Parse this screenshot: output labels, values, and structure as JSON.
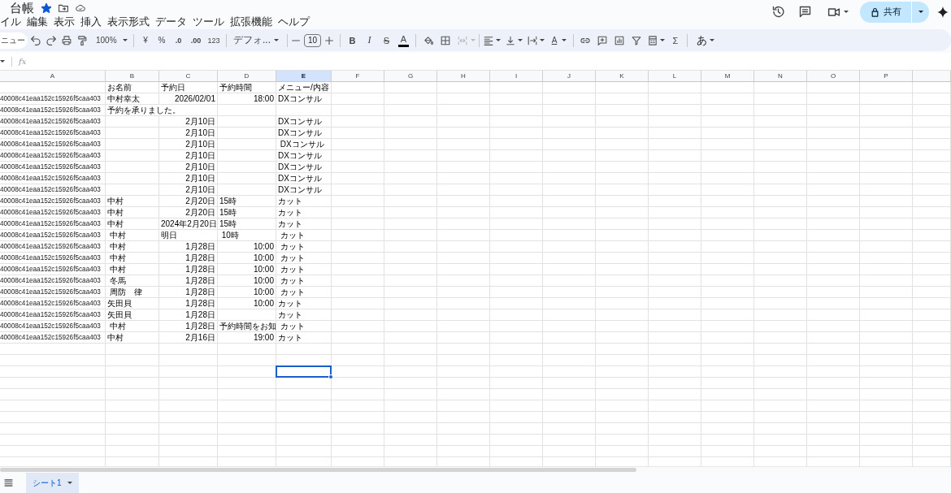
{
  "document": {
    "title": "台帳",
    "starred": true
  },
  "menu": [
    "イル",
    "編集",
    "表示",
    "挿入",
    "表示形式",
    "データ",
    "ツール",
    "拡張機能",
    "ヘルプ"
  ],
  "share_button": {
    "label": "共有"
  },
  "toolbar": {
    "search_placeholder": "ニュー",
    "zoom": "100%",
    "currency": "¥",
    "percent": "%",
    "decimal_decrease": ".0",
    "decimal_increase": ".00",
    "number_format": "123",
    "font": "デフォ...",
    "font_size": "10",
    "bold": "B",
    "italic": "I",
    "strikethrough": "S",
    "text_color": "A",
    "merge_cells": {
      "disabled": true
    },
    "text_rotation": "A",
    "sum": "Σ",
    "input_tools": "あ"
  },
  "formula_bar": {
    "label": "fx"
  },
  "grid": {
    "columns": [
      {
        "label": "A",
        "selected": false
      },
      {
        "label": "B",
        "selected": false
      },
      {
        "label": "C",
        "selected": false
      },
      {
        "label": "D",
        "selected": false
      },
      {
        "label": "E",
        "selected": true
      },
      {
        "label": "F",
        "selected": false
      },
      {
        "label": "G",
        "selected": false
      },
      {
        "label": "H",
        "selected": false
      },
      {
        "label": "I",
        "selected": false
      },
      {
        "label": "J",
        "selected": false
      },
      {
        "label": "K",
        "selected": false
      },
      {
        "label": "L",
        "selected": false
      },
      {
        "label": "M",
        "selected": false
      },
      {
        "label": "N",
        "selected": false
      },
      {
        "label": "O",
        "selected": false
      },
      {
        "label": "P",
        "selected": false
      }
    ],
    "rows": [
      {
        "selected": false,
        "cells": {
          "B": {
            "text": "お名前",
            "kind": "text"
          },
          "C": {
            "text": "予約日",
            "kind": "text"
          },
          "D": {
            "text": "予約時間",
            "kind": "text"
          },
          "E": {
            "text": "メニュー/内容",
            "kind": "text"
          }
        }
      },
      {
        "selected": false,
        "cells": {
          "A": {
            "text": "40008c41eaa152c15926f5caa403",
            "kind": "text"
          },
          "B": {
            "text": "中村幸太",
            "kind": "text"
          },
          "C": {
            "text": "2026/02/01",
            "kind": "number"
          },
          "D": {
            "text": "18:00",
            "kind": "number"
          },
          "E": {
            "text": "DXコンサル",
            "kind": "text"
          }
        }
      },
      {
        "selected": false,
        "cells": {
          "A": {
            "text": "40008c41eaa152c15926f5caa403",
            "kind": "text"
          },
          "B": {
            "text": "予約を承りました。",
            "kind": "overflow_text"
          }
        }
      },
      {
        "selected": false,
        "cells": {
          "A": {
            "text": "40008c41eaa152c15926f5caa403",
            "kind": "text"
          },
          "C": {
            "text": "2月10日",
            "kind": "number"
          },
          "E": {
            "text": "DXコンサル",
            "kind": "text"
          }
        }
      },
      {
        "selected": false,
        "cells": {
          "A": {
            "text": "40008c41eaa152c15926f5caa403",
            "kind": "text"
          },
          "C": {
            "text": "2月10日",
            "kind": "number"
          },
          "E": {
            "text": "DXコンサル",
            "kind": "text"
          }
        }
      },
      {
        "selected": false,
        "cells": {
          "A": {
            "text": "40008c41eaa152c15926f5caa403",
            "kind": "text"
          },
          "C": {
            "text": "2月10日",
            "kind": "number"
          },
          "E": {
            "text": " DXコンサル",
            "kind": "text"
          }
        }
      },
      {
        "selected": false,
        "cells": {
          "A": {
            "text": "40008c41eaa152c15926f5caa403",
            "kind": "text"
          },
          "C": {
            "text": "2月10日",
            "kind": "number"
          },
          "E": {
            "text": "DXコンサル",
            "kind": "text"
          }
        }
      },
      {
        "selected": false,
        "cells": {
          "A": {
            "text": "40008c41eaa152c15926f5caa403",
            "kind": "text"
          },
          "C": {
            "text": "2月10日",
            "kind": "number"
          },
          "E": {
            "text": "DXコンサル",
            "kind": "text"
          }
        }
      },
      {
        "selected": false,
        "cells": {
          "A": {
            "text": "40008c41eaa152c15926f5caa403",
            "kind": "text"
          },
          "C": {
            "text": "2月10日",
            "kind": "number"
          },
          "E": {
            "text": "DXコンサル",
            "kind": "text"
          }
        }
      },
      {
        "selected": false,
        "cells": {
          "A": {
            "text": "40008c41eaa152c15926f5caa403",
            "kind": "text"
          },
          "C": {
            "text": "2月10日",
            "kind": "number"
          },
          "E": {
            "text": "DXコンサル",
            "kind": "text"
          }
        }
      },
      {
        "selected": false,
        "cells": {
          "A": {
            "text": "40008c41eaa152c15926f5caa403",
            "kind": "text"
          },
          "B": {
            "text": "中村",
            "kind": "text"
          },
          "C": {
            "text": "2月20日",
            "kind": "number"
          },
          "D": {
            "text": "15時",
            "kind": "text"
          },
          "E": {
            "text": "カット",
            "kind": "text"
          }
        }
      },
      {
        "selected": false,
        "cells": {
          "A": {
            "text": "40008c41eaa152c15926f5caa403",
            "kind": "text"
          },
          "B": {
            "text": "中村",
            "kind": "text"
          },
          "C": {
            "text": "2月20日",
            "kind": "number"
          },
          "D": {
            "text": "15時",
            "kind": "text"
          },
          "E": {
            "text": "カット",
            "kind": "text"
          }
        }
      },
      {
        "selected": false,
        "cells": {
          "A": {
            "text": "40008c41eaa152c15926f5caa403",
            "kind": "text"
          },
          "B": {
            "text": "中村",
            "kind": "text"
          },
          "C": {
            "text": "2024年2月20日",
            "kind": "number"
          },
          "D": {
            "text": "15時",
            "kind": "text"
          },
          "E": {
            "text": "カット",
            "kind": "text"
          }
        }
      },
      {
        "selected": false,
        "cells": {
          "A": {
            "text": "40008c41eaa152c15926f5caa403",
            "kind": "text"
          },
          "B": {
            "text": " 中村",
            "kind": "text"
          },
          "C": {
            "text": "明日",
            "kind": "text"
          },
          "D": {
            "text": " 10時",
            "kind": "text"
          },
          "E": {
            "text": " カット",
            "kind": "text"
          }
        }
      },
      {
        "selected": false,
        "cells": {
          "A": {
            "text": "40008c41eaa152c15926f5caa403",
            "kind": "text"
          },
          "B": {
            "text": " 中村",
            "kind": "text"
          },
          "C": {
            "text": "1月28日",
            "kind": "number"
          },
          "D": {
            "text": "10:00",
            "kind": "number"
          },
          "E": {
            "text": " カット",
            "kind": "text"
          }
        }
      },
      {
        "selected": false,
        "cells": {
          "A": {
            "text": "40008c41eaa152c15926f5caa403",
            "kind": "text"
          },
          "B": {
            "text": " 中村",
            "kind": "text"
          },
          "C": {
            "text": "1月28日",
            "kind": "number"
          },
          "D": {
            "text": "10:00",
            "kind": "number"
          },
          "E": {
            "text": " カット",
            "kind": "text"
          }
        }
      },
      {
        "selected": false,
        "cells": {
          "A": {
            "text": "40008c41eaa152c15926f5caa403",
            "kind": "text"
          },
          "B": {
            "text": " 中村",
            "kind": "text"
          },
          "C": {
            "text": "1月28日",
            "kind": "number"
          },
          "D": {
            "text": "10:00",
            "kind": "number"
          },
          "E": {
            "text": " カット",
            "kind": "text"
          }
        }
      },
      {
        "selected": false,
        "cells": {
          "A": {
            "text": "40008c41eaa152c15926f5caa403",
            "kind": "text"
          },
          "B": {
            "text": " 冬馬",
            "kind": "text"
          },
          "C": {
            "text": "1月28日",
            "kind": "number"
          },
          "D": {
            "text": "10:00",
            "kind": "number"
          },
          "E": {
            "text": " カット",
            "kind": "text"
          }
        }
      },
      {
        "selected": false,
        "cells": {
          "A": {
            "text": "40008c41eaa152c15926f5caa403",
            "kind": "text"
          },
          "B": {
            "text": " 周防　律",
            "kind": "text"
          },
          "C": {
            "text": "1月28日",
            "kind": "number"
          },
          "D": {
            "text": "10:00",
            "kind": "number"
          },
          "E": {
            "text": " カット",
            "kind": "text"
          }
        }
      },
      {
        "selected": false,
        "cells": {
          "A": {
            "text": "40008c41eaa152c15926f5caa403",
            "kind": "text"
          },
          "B": {
            "text": "矢田貝",
            "kind": "text"
          },
          "C": {
            "text": "1月28日",
            "kind": "number"
          },
          "D": {
            "text": "10:00",
            "kind": "number"
          },
          "E": {
            "text": "カット",
            "kind": "text"
          }
        }
      },
      {
        "selected": false,
        "cells": {
          "A": {
            "text": "40008c41eaa152c15926f5caa403",
            "kind": "text"
          },
          "B": {
            "text": "矢田貝",
            "kind": "text"
          },
          "C": {
            "text": "1月28日",
            "kind": "number"
          },
          "E": {
            "text": "カット",
            "kind": "text"
          }
        }
      },
      {
        "selected": false,
        "cells": {
          "A": {
            "text": "40008c41eaa152c15926f5caa403",
            "kind": "text"
          },
          "B": {
            "text": " 中村",
            "kind": "text"
          },
          "C": {
            "text": "1月28日",
            "kind": "number"
          },
          "D": {
            "text": "予約時間をお知",
            "kind": "text"
          },
          "E": {
            "text": " カット",
            "kind": "text"
          }
        }
      },
      {
        "selected": false,
        "cells": {
          "A": {
            "text": "40008c41eaa152c15926f5caa403",
            "kind": "text"
          },
          "B": {
            "text": "中村",
            "kind": "text"
          },
          "C": {
            "text": "2月16日",
            "kind": "number"
          },
          "D": {
            "text": "19:00",
            "kind": "number"
          },
          "E": {
            "text": "カット",
            "kind": "text"
          }
        }
      },
      {
        "selected": false
      },
      {
        "selected": false
      },
      {
        "selected": true
      }
    ]
  },
  "sheet_tabs": [
    {
      "label": "シート1",
      "selected": true
    }
  ]
}
